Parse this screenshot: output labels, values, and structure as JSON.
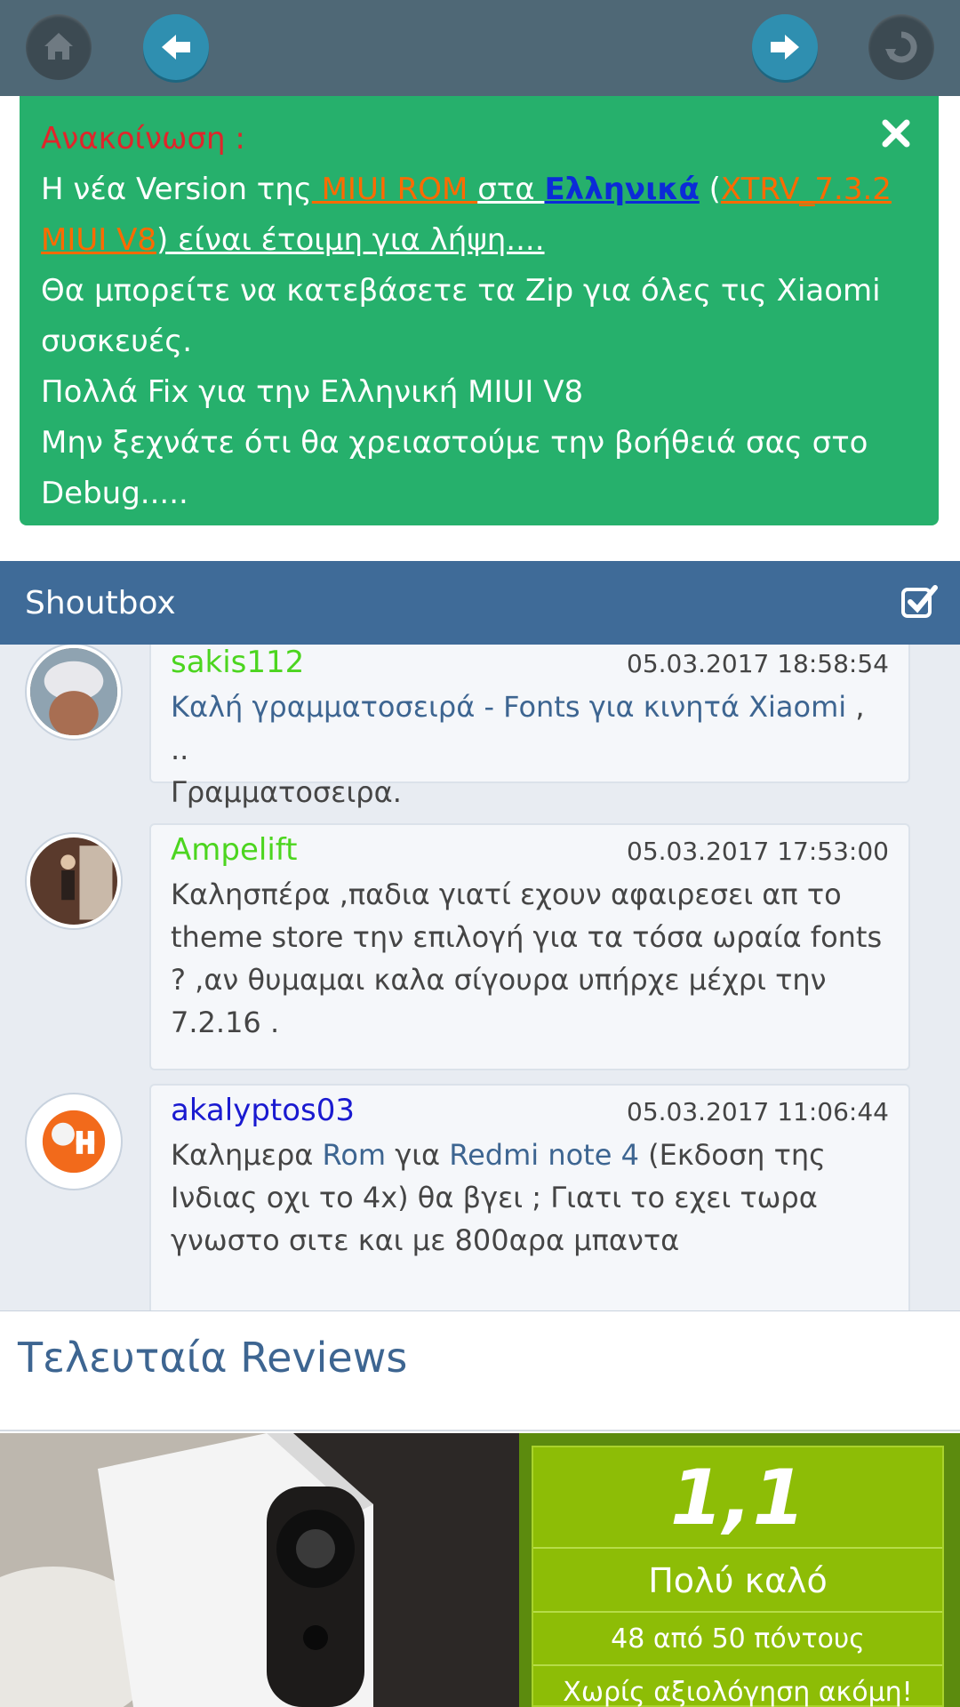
{
  "toolbar": {
    "icons": [
      "home-icon",
      "back-arrow-icon",
      "forward-arrow-icon",
      "refresh-icon"
    ]
  },
  "announcement": {
    "title": "Ανακοίνωση :",
    "line1_prefix": "Η νέα Version της",
    "line1_rom": " MIUI ROM ",
    "line1_mid": "στα ",
    "line1_greek": "Ελληνικά",
    "line1_open": " (",
    "line1_version": "XTRV_7.3.2",
    "line2_version": "MIUI V8",
    "line2_rest": ") είναι έτοιμη για λήψη....",
    "line3": "Θα μπορείτε να κατεβάσετε τα Zip για όλες τις Xiaomi",
    "line4": "συσκευές.",
    "line5": "Πολλά Fix για την Ελληνική MIUI V8",
    "line6": "Μην ξεχνάτε ότι θα χρειαστούμε την βοήθειά σας στο",
    "line7": "Debug....."
  },
  "shoutbox": {
    "title": "Shoutbox",
    "messages": [
      {
        "user": "sakis112",
        "time": "05.03.2017 18:58:54",
        "link": "Καλή γραμματοσειρά - Fonts για κινητά Xiaomi",
        "after_link": " , ..",
        "line2": "Γραμματοσειρα."
      },
      {
        "user": "Ampelift",
        "time": "05.03.2017 17:53:00",
        "line1": "Καλησπέρα ,παδια γιατί εχουν αφαιρεσει απ το",
        "line2": "theme store την επιλογή για τα τόσα ωραία fonts",
        "line3": "? ,αν θυμαμαι καλα σίγουρα υπήρχε μέχρι την",
        "line4": "7.2.16 ."
      },
      {
        "user": "akalyptos03",
        "time": "05.03.2017 11:06:44",
        "pre": "Καλημερα ",
        "link1": "Rom",
        "mid": " για ",
        "link2": "Redmi note 4",
        "post": " (Εκδοση της",
        "line2": "Ινδιας οχι το 4x) θα βγει ; Γιατι το εχει τωρα",
        "line3": "γνωστο σιτε και με 800αρα μπαντα"
      }
    ]
  },
  "reviews": {
    "title": "Τελευταία Reviews",
    "score": "1,1",
    "label": "Πολύ καλό",
    "points": "48 από 50 πόντους",
    "note": "Χωρίς αξιολόγηση ακόμη!"
  },
  "colors": {
    "toolbar": "#4f6876",
    "announcement_bg": "#26b06c",
    "shoutbox_header": "#3f6b98",
    "score_bg": "#8dbd06"
  }
}
